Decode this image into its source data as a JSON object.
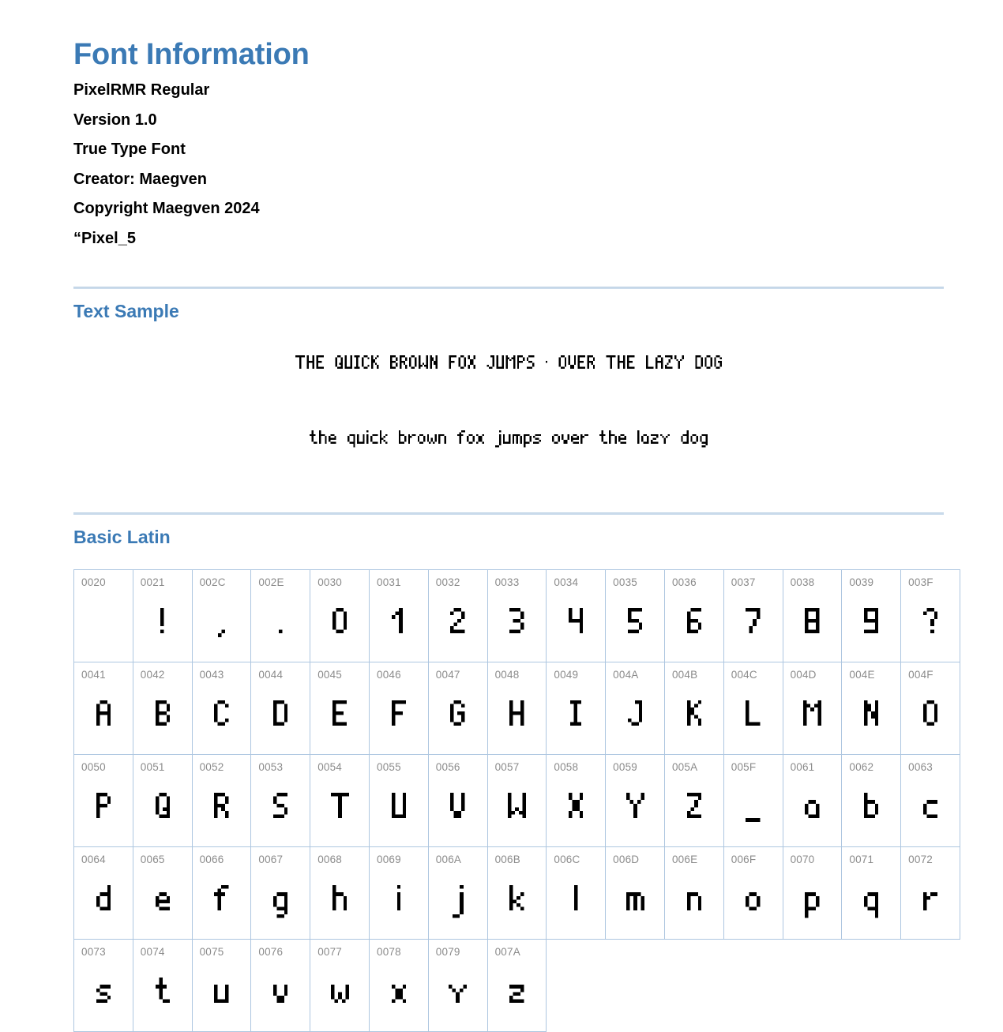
{
  "document": {
    "title": "Font Information",
    "meta": [
      "PixelRMR Regular",
      "Version 1.0",
      "True Type Font",
      "Creator: Maegven",
      "Copyright Maegven 2024",
      "“Pixel_5"
    ]
  },
  "sections": {
    "text_sample": {
      "heading": "Text Sample",
      "uppercase_sample": "THE QUICK BROWN FOX JUMPS · OVER THE LAZY DOG",
      "lowercase_sample": "the quick brown fox jumps over the lazy dog"
    },
    "basic_latin": {
      "heading": "Basic Latin",
      "columns": 15,
      "glyphs": [
        {
          "codepoint": "0020",
          "char": " "
        },
        {
          "codepoint": "0021",
          "char": "!"
        },
        {
          "codepoint": "002C",
          "char": ","
        },
        {
          "codepoint": "002E",
          "char": "."
        },
        {
          "codepoint": "0030",
          "char": "0"
        },
        {
          "codepoint": "0031",
          "char": "1"
        },
        {
          "codepoint": "0032",
          "char": "2"
        },
        {
          "codepoint": "0033",
          "char": "3"
        },
        {
          "codepoint": "0034",
          "char": "4"
        },
        {
          "codepoint": "0035",
          "char": "5"
        },
        {
          "codepoint": "0036",
          "char": "6"
        },
        {
          "codepoint": "0037",
          "char": "7"
        },
        {
          "codepoint": "0038",
          "char": "8"
        },
        {
          "codepoint": "0039",
          "char": "9"
        },
        {
          "codepoint": "003F",
          "char": "?"
        },
        {
          "codepoint": "0041",
          "char": "A"
        },
        {
          "codepoint": "0042",
          "char": "B"
        },
        {
          "codepoint": "0043",
          "char": "C"
        },
        {
          "codepoint": "0044",
          "char": "D"
        },
        {
          "codepoint": "0045",
          "char": "E"
        },
        {
          "codepoint": "0046",
          "char": "F"
        },
        {
          "codepoint": "0047",
          "char": "G"
        },
        {
          "codepoint": "0048",
          "char": "H"
        },
        {
          "codepoint": "0049",
          "char": "I"
        },
        {
          "codepoint": "004A",
          "char": "J"
        },
        {
          "codepoint": "004B",
          "char": "K"
        },
        {
          "codepoint": "004C",
          "char": "L"
        },
        {
          "codepoint": "004D",
          "char": "M"
        },
        {
          "codepoint": "004E",
          "char": "N"
        },
        {
          "codepoint": "004F",
          "char": "O"
        },
        {
          "codepoint": "0050",
          "char": "P"
        },
        {
          "codepoint": "0051",
          "char": "Q"
        },
        {
          "codepoint": "0052",
          "char": "R"
        },
        {
          "codepoint": "0053",
          "char": "S"
        },
        {
          "codepoint": "0054",
          "char": "T"
        },
        {
          "codepoint": "0055",
          "char": "U"
        },
        {
          "codepoint": "0056",
          "char": "V"
        },
        {
          "codepoint": "0057",
          "char": "W"
        },
        {
          "codepoint": "0058",
          "char": "X"
        },
        {
          "codepoint": "0059",
          "char": "Y"
        },
        {
          "codepoint": "005A",
          "char": "Z"
        },
        {
          "codepoint": "005F",
          "char": "_"
        },
        {
          "codepoint": "0061",
          "char": "a"
        },
        {
          "codepoint": "0062",
          "char": "b"
        },
        {
          "codepoint": "0063",
          "char": "c"
        },
        {
          "codepoint": "0064",
          "char": "d"
        },
        {
          "codepoint": "0065",
          "char": "e"
        },
        {
          "codepoint": "0066",
          "char": "f"
        },
        {
          "codepoint": "0067",
          "char": "g"
        },
        {
          "codepoint": "0068",
          "char": "h"
        },
        {
          "codepoint": "0069",
          "char": "i"
        },
        {
          "codepoint": "006A",
          "char": "j"
        },
        {
          "codepoint": "006B",
          "char": "k"
        },
        {
          "codepoint": "006C",
          "char": "l"
        },
        {
          "codepoint": "006D",
          "char": "m"
        },
        {
          "codepoint": "006E",
          "char": "n"
        },
        {
          "codepoint": "006F",
          "char": "o"
        },
        {
          "codepoint": "0070",
          "char": "p"
        },
        {
          "codepoint": "0071",
          "char": "q"
        },
        {
          "codepoint": "0072",
          "char": "r"
        },
        {
          "codepoint": "0073",
          "char": "s"
        },
        {
          "codepoint": "0074",
          "char": "t"
        },
        {
          "codepoint": "0075",
          "char": "u"
        },
        {
          "codepoint": "0076",
          "char": "v"
        },
        {
          "codepoint": "0077",
          "char": "w"
        },
        {
          "codepoint": "0078",
          "char": "x"
        },
        {
          "codepoint": "0079",
          "char": "y"
        },
        {
          "codepoint": "007A",
          "char": "z"
        }
      ]
    }
  },
  "colors": {
    "heading_blue": "#3b7ab5",
    "divider_blue": "#ccdcec",
    "table_border": "#adc6e0",
    "codepoint_gray": "#8b8b8b",
    "glyph_black": "#000000",
    "background": "#ffffff"
  }
}
